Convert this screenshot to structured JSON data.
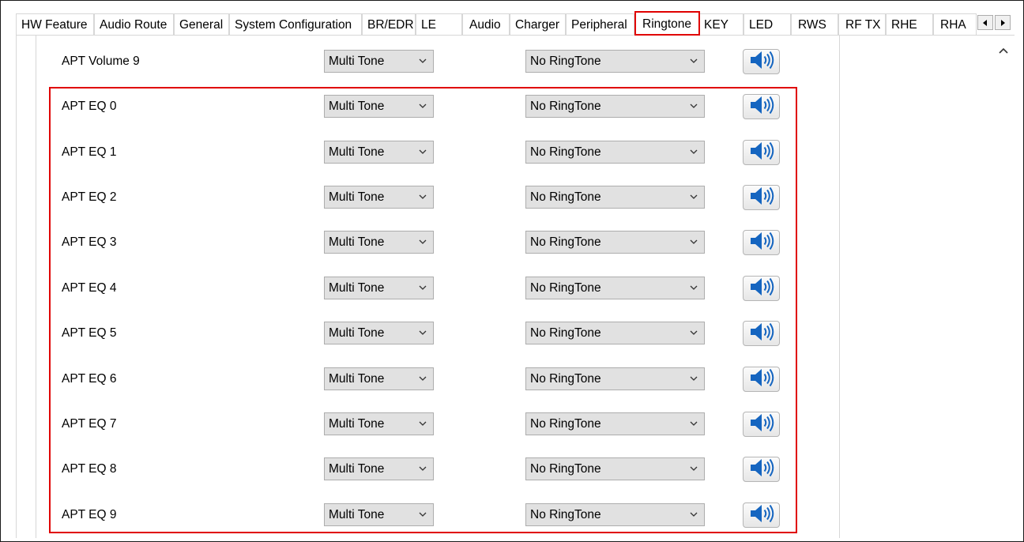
{
  "tabs": [
    {
      "label": "HW Feature"
    },
    {
      "label": "Audio Route"
    },
    {
      "label": "General"
    },
    {
      "label": "System Configuration"
    },
    {
      "label": "BR/EDR"
    },
    {
      "label": "LE"
    },
    {
      "label": "Audio"
    },
    {
      "label": "Charger"
    },
    {
      "label": "Peripheral"
    },
    {
      "label": "Ringtone"
    },
    {
      "label": "KEY"
    },
    {
      "label": "LED"
    },
    {
      "label": "RWS"
    },
    {
      "label": "RF TX"
    },
    {
      "label": "RHE"
    },
    {
      "label": "RHA"
    }
  ],
  "active_tab": "Ringtone",
  "rows": [
    {
      "label": "APT Volume 9",
      "tone_type": "Multi Tone",
      "ringtone": "No RingTone"
    },
    {
      "label": "APT EQ 0",
      "tone_type": "Multi Tone",
      "ringtone": "No RingTone"
    },
    {
      "label": "APT EQ 1",
      "tone_type": "Multi Tone",
      "ringtone": "No RingTone"
    },
    {
      "label": "APT EQ 2",
      "tone_type": "Multi Tone",
      "ringtone": "No RingTone"
    },
    {
      "label": "APT EQ 3",
      "tone_type": "Multi Tone",
      "ringtone": "No RingTone"
    },
    {
      "label": "APT EQ 4",
      "tone_type": "Multi Tone",
      "ringtone": "No RingTone"
    },
    {
      "label": "APT EQ 5",
      "tone_type": "Multi Tone",
      "ringtone": "No RingTone"
    },
    {
      "label": "APT EQ 6",
      "tone_type": "Multi Tone",
      "ringtone": "No RingTone"
    },
    {
      "label": "APT EQ 7",
      "tone_type": "Multi Tone",
      "ringtone": "No RingTone"
    },
    {
      "label": "APT EQ 8",
      "tone_type": "Multi Tone",
      "ringtone": "No RingTone"
    },
    {
      "label": "APT EQ 9",
      "tone_type": "Multi Tone",
      "ringtone": "No RingTone"
    }
  ],
  "icons": {
    "play": "speaker-icon",
    "tab_left": "arrow-left-icon",
    "tab_right": "arrow-right-icon",
    "scroll_up": "chevron-up-icon",
    "dropdown": "chevron-down-icon"
  },
  "colors": {
    "highlight": "#e00000",
    "speaker": "#1565c0"
  }
}
